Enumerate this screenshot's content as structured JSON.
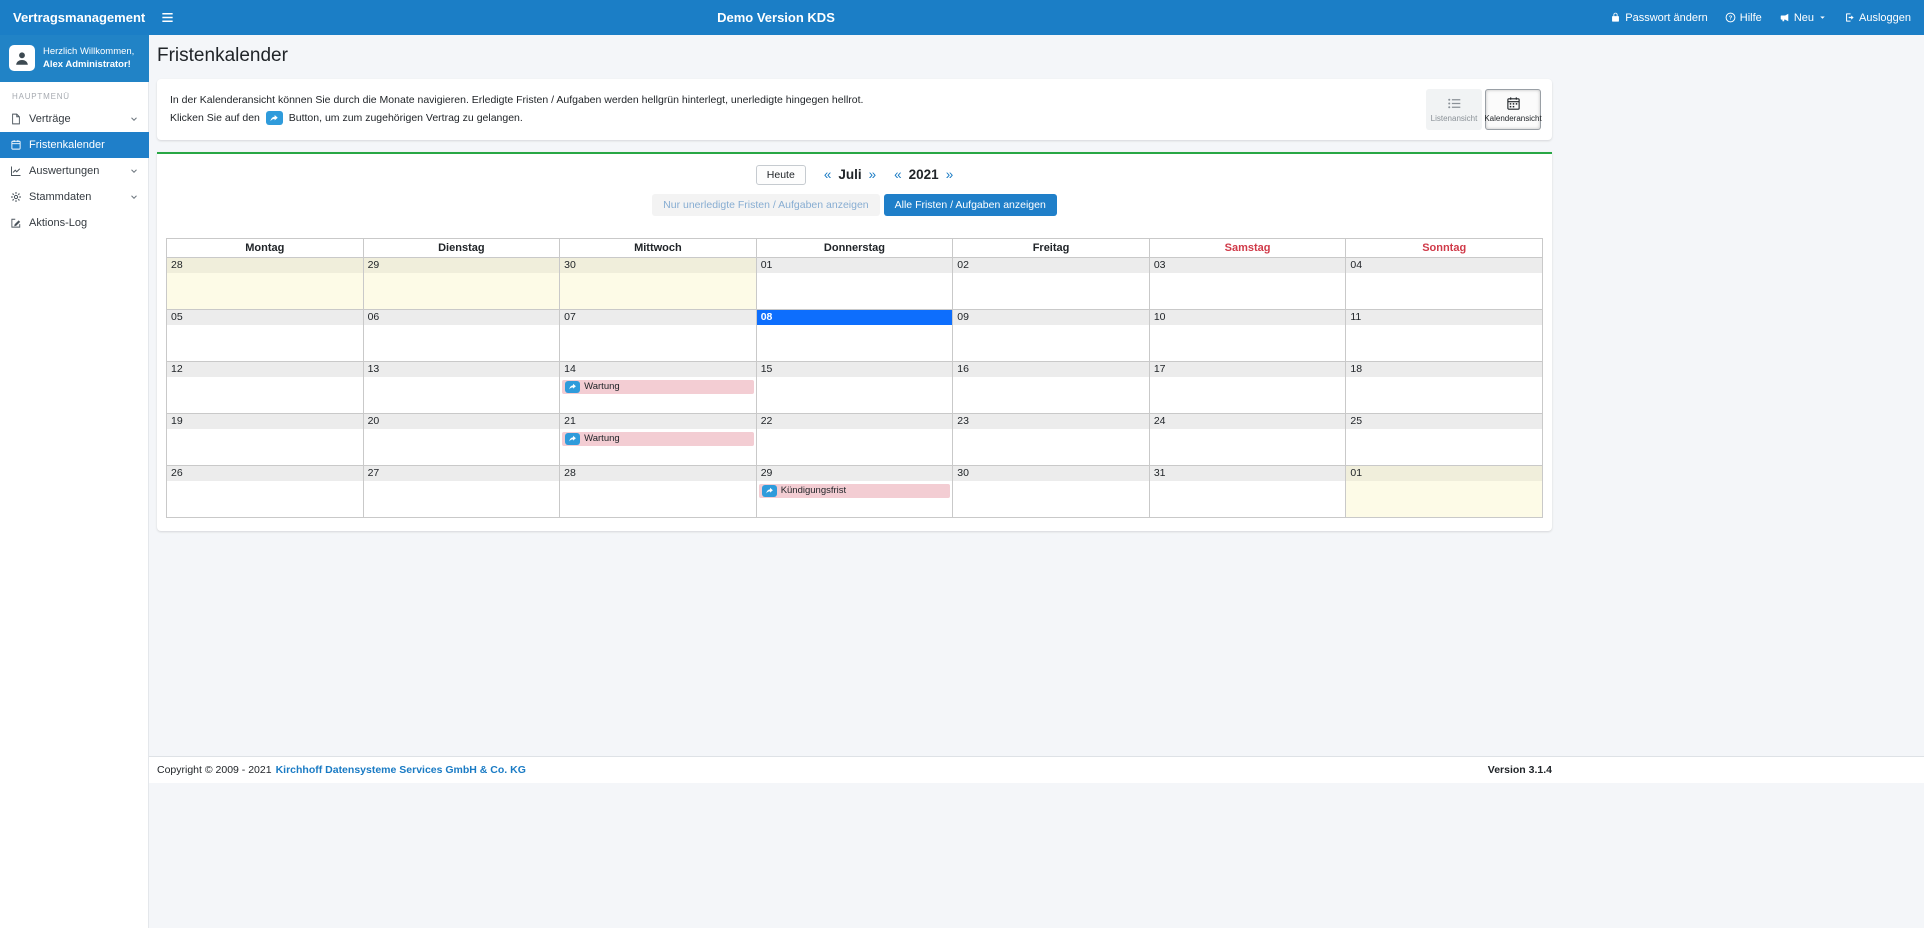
{
  "topbar": {
    "brand": "Vertragsmanagement",
    "title": "Demo Version KDS",
    "actions": [
      {
        "id": "passwort-aendern",
        "label": "Passwort ändern",
        "icon": "lock-icon"
      },
      {
        "id": "hilfe",
        "label": "Hilfe",
        "icon": "help-icon"
      },
      {
        "id": "neu",
        "label": "Neu",
        "icon": "megaphone-icon",
        "dropdown": true
      },
      {
        "id": "ausloggen",
        "label": "Ausloggen",
        "icon": "logout-icon"
      }
    ]
  },
  "sidebar": {
    "welcome_line1": "Herzlich Willkommen,",
    "welcome_line2": "Alex Administrator!",
    "section_label": "HAUPTMENÜ",
    "items": [
      {
        "id": "vertraege",
        "label": "Verträge",
        "icon": "file-icon",
        "expandable": true,
        "active": false
      },
      {
        "id": "fristenkalender",
        "label": "Fristenkalender",
        "icon": "calendar-icon",
        "expandable": false,
        "active": true
      },
      {
        "id": "auswertungen",
        "label": "Auswertungen",
        "icon": "chart-icon",
        "expandable": true,
        "active": false
      },
      {
        "id": "stammdaten",
        "label": "Stammdaten",
        "icon": "gear-icon",
        "expandable": true,
        "active": false
      },
      {
        "id": "aktions-log",
        "label": "Aktions-Log",
        "icon": "edit-icon",
        "expandable": false,
        "active": false
      }
    ]
  },
  "page": {
    "title": "Fristenkalender",
    "info_line1": "In der Kalenderansicht können Sie durch die Monate navigieren. Erledigte Fristen / Aufgaben werden hellgrün hinterlegt, unerledigte hingegen hellrot.",
    "info_line2_prefix": "Klicken Sie auf den",
    "info_line2_suffix": "Button, um zum zugehörigen Vertrag zu gelangen.",
    "view_toggle": {
      "list_label": "Listenansicht",
      "calendar_label": "Kalenderansicht"
    }
  },
  "calendar": {
    "today_button": "Heute",
    "prev_symbol": "«",
    "next_symbol": "»",
    "month": "Juli",
    "year": "2021",
    "filter_unfinished": "Nur unerledigte Fristen / Aufgaben anzeigen",
    "filter_all": "Alle Fristen / Aufgaben anzeigen",
    "weekdays": [
      "Montag",
      "Dienstag",
      "Mittwoch",
      "Donnerstag",
      "Freitag",
      "Samstag",
      "Sonntag"
    ],
    "weeks": [
      [
        {
          "day": "28",
          "muted": true
        },
        {
          "day": "29",
          "muted": true
        },
        {
          "day": "30",
          "muted": true
        },
        {
          "day": "01"
        },
        {
          "day": "02"
        },
        {
          "day": "03"
        },
        {
          "day": "04"
        }
      ],
      [
        {
          "day": "05"
        },
        {
          "day": "06"
        },
        {
          "day": "07"
        },
        {
          "day": "08",
          "today": true
        },
        {
          "day": "09"
        },
        {
          "day": "10"
        },
        {
          "day": "11"
        }
      ],
      [
        {
          "day": "12"
        },
        {
          "day": "13"
        },
        {
          "day": "14",
          "events": [
            {
              "label": "Wartung",
              "status": "unerledigt"
            }
          ]
        },
        {
          "day": "15"
        },
        {
          "day": "16"
        },
        {
          "day": "17"
        },
        {
          "day": "18"
        }
      ],
      [
        {
          "day": "19"
        },
        {
          "day": "20"
        },
        {
          "day": "21",
          "events": [
            {
              "label": "Wartung",
              "status": "unerledigt"
            }
          ]
        },
        {
          "day": "22"
        },
        {
          "day": "23"
        },
        {
          "day": "24"
        },
        {
          "day": "25"
        }
      ],
      [
        {
          "day": "26"
        },
        {
          "day": "27"
        },
        {
          "day": "28"
        },
        {
          "day": "29",
          "events": [
            {
              "label": "Kündigungsfrist",
              "status": "unerledigt"
            }
          ]
        },
        {
          "day": "30"
        },
        {
          "day": "31"
        },
        {
          "day": "01",
          "muted": true
        }
      ]
    ]
  },
  "footer": {
    "copyright": "Copyright © 2009 - 2021",
    "company_link": "Kirchhoff Datensysteme Services GmbH & Co. KG",
    "version": "Version 3.1.4"
  },
  "colors": {
    "topbar_blue": "#1b7ec6",
    "accent_blue": "#1f7fc9",
    "today_blue": "#0d6efd",
    "mini_button_blue": "#2f9bdb",
    "green_divider": "#28a745",
    "weekend_red": "#d03a49",
    "event_pink": "#f3cdd3",
    "muted_day_yellow": "#fdfbe7",
    "link_blue": "#1a7bc4"
  }
}
